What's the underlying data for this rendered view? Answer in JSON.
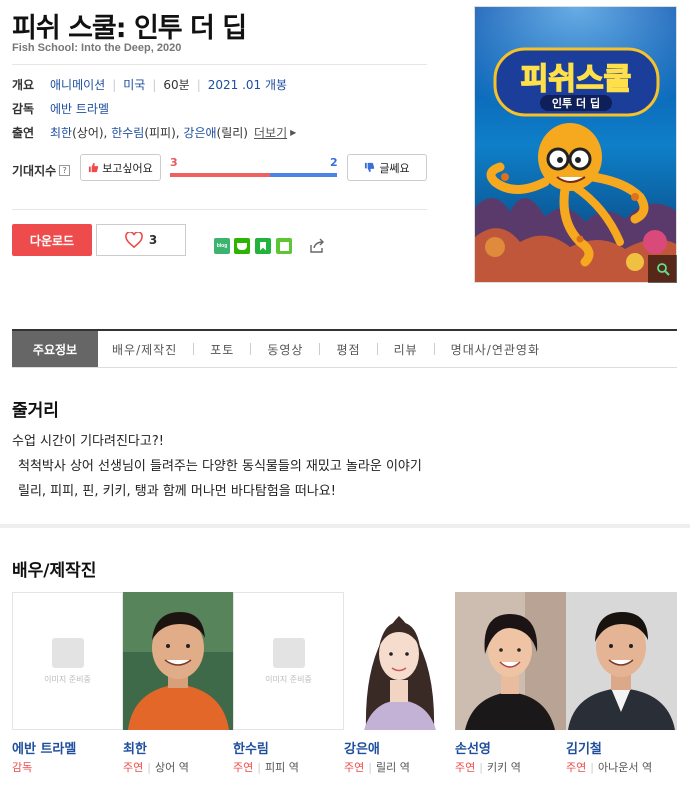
{
  "movie": {
    "title": "피쉬 스쿨: 인투 더 딥",
    "subtitle": "Fish School: Into the Deep, 2020",
    "overview_label": "개요",
    "genre": "애니메이션",
    "country": "미국",
    "runtime": "60분",
    "release": "2021 .01 개봉",
    "director_label": "감독",
    "director": "에반 트라멜",
    "cast_label": "출연",
    "cast_line": [
      {
        "name": "최한",
        "role": "(상어)"
      },
      {
        "name": "한수림",
        "role": "(피피)"
      },
      {
        "name": "강은애",
        "role": "(릴리)"
      }
    ],
    "more_label": "더보기",
    "poster_title": "피쉬스쿨",
    "poster_subtitle": "인투 더 딥"
  },
  "expectation": {
    "label": "기대지수",
    "help_icon": "?",
    "want_label": "보고싶어요",
    "want_count": "3",
    "nah_label": "글쎄요",
    "nah_count": "2",
    "want_ratio": 0.6
  },
  "actions": {
    "download_label": "다운로드",
    "like_count": "3"
  },
  "share_icons": [
    {
      "name": "blog",
      "color": "#3cb371"
    },
    {
      "name": "cafe",
      "color": "#2db400"
    },
    {
      "name": "bookmark",
      "color": "#21b33c"
    },
    {
      "name": "memo",
      "color": "#5fc633"
    }
  ],
  "tabs": [
    "주요정보",
    "배우/제작진",
    "포토",
    "동영상",
    "평점",
    "리뷰",
    "명대사/연관영화"
  ],
  "story": {
    "heading": "줄거리",
    "lines": [
      "수업 시간이 기다려진다고?!",
      "척척박사 상어 선생님이 들려주는 다양한 동식물들의 재밌고 놀라운 이야기",
      "릴리, 피피, 핀, 키키, 탱과 함께 머나먼 바다탐험을 떠나요!"
    ]
  },
  "cast_section": {
    "heading": "배우/제작진",
    "placeholder_text": "이미지 준비중",
    "people": [
      {
        "name": "에반 트라멜",
        "role": "감독",
        "character": ""
      },
      {
        "name": "최한",
        "role": "주연",
        "character": "상어 역"
      },
      {
        "name": "한수림",
        "role": "주연",
        "character": "피피 역"
      },
      {
        "name": "강은애",
        "role": "주연",
        "character": "릴리 역"
      },
      {
        "name": "손선영",
        "role": "주연",
        "character": "키키 역"
      },
      {
        "name": "김기철",
        "role": "주연",
        "character": "아나운서 역"
      }
    ]
  },
  "colors": {
    "accent_red": "#ee4c4c",
    "link_blue": "#1f4e9e",
    "bar_blue": "#4a84e8"
  }
}
